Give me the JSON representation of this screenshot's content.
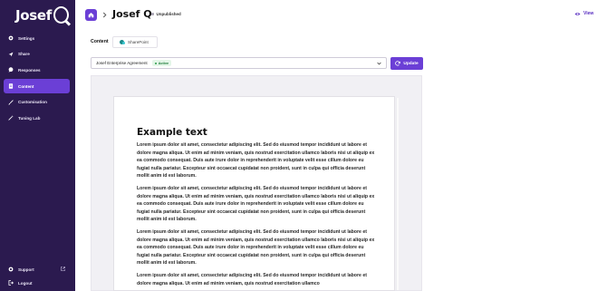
{
  "brand": {
    "name": "Josef"
  },
  "sidebar": {
    "items": [
      {
        "label": "Settings",
        "icon": "gear-icon"
      },
      {
        "label": "Share",
        "icon": "share-icon"
      },
      {
        "label": "Responses",
        "icon": "chat-icon"
      },
      {
        "label": "Content",
        "icon": "document-icon",
        "active": true
      },
      {
        "label": "Customisation",
        "icon": "brush-icon"
      },
      {
        "label": "Tuning Lab",
        "icon": "wand-icon"
      }
    ],
    "support_label": "Support",
    "logout_label": "Logout"
  },
  "header": {
    "title": "Josef Q",
    "status": "Unpublished",
    "view_label": "View"
  },
  "content": {
    "label": "Content",
    "source_label": "SharePoint",
    "select_value": "Josef Enterprise Agreement",
    "badge": "Active",
    "update_label": "Update"
  },
  "document": {
    "title": "Example text",
    "paragraphs": [
      "Lorem ipsum dolor sit amet, consectetur adipiscing elit. Sed do eiusmod tempor incididunt ut labore et dolore magna aliqua. Ut enim ad minim veniam, quis nostrud exercitation ullamco laboris nisi ut aliquip ex ea commodo consequat. Duis aute irure dolor in reprehenderit in voluptate velit esse cillum dolore eu fugiat nulla pariatur. Excepteur sint occaecat cupidatat non proident, sunt in culpa qui officia deserunt mollit anim id est laborum.",
      "Lorem ipsum dolor sit amet, consectetur adipiscing elit. Sed do eiusmod tempor incididunt ut labore et dolore magna aliqua. Ut enim ad minim veniam, quis nostrud exercitation ullamco laboris nisi ut aliquip ex ea commodo consequat. Duis aute irure dolor in reprehenderit in voluptate velit esse cillum dolore eu fugiat nulla pariatur. Excepteur sint occaecat cupidatat non proident, sunt in culpa qui officia deserunt mollit anim id est laborum.",
      "Lorem ipsum dolor sit amet, consectetur adipiscing elit. Sed do eiusmod tempor incididunt ut labore et dolore magna aliqua. Ut enim ad minim veniam, quis nostrud exercitation ullamco laboris nisi ut aliquip ex ea commodo consequat. Duis aute irure dolor in reprehenderit in voluptate velit esse cillum dolore eu fugiat nulla pariatur. Excepteur sint occaecat cupidatat non proident, sunt in culpa qui officia deserunt mollit anim id est laborum.",
      "Lorem ipsum dolor sit amet, consectetur adipiscing elit. Sed do eiusmod tempor incididunt ut labore et dolore magna aliqua. Ut enim ad minim veniam, quis nostrud exercitation ullamco"
    ]
  },
  "colors": {
    "sidebar_bg": "#2b1a4f",
    "accent": "#6b3fd6",
    "active_badge": "#1e7b3a"
  }
}
